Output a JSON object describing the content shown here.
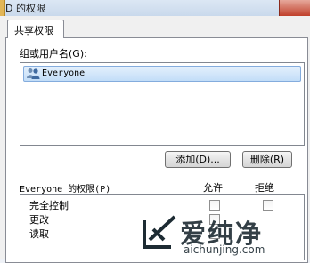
{
  "window": {
    "title": "D 的权限"
  },
  "tabs": [
    {
      "label": "共享权限",
      "active": true
    }
  ],
  "groups": {
    "label": "组或用户名(G):",
    "items": [
      {
        "name": "Everyone",
        "icon": "user-group-icon",
        "selected": true
      }
    ]
  },
  "buttons": {
    "add": "添加(D)...",
    "remove": "删除(R)"
  },
  "permissions": {
    "header": "Everyone 的权限(P)",
    "allow_label": "允许",
    "deny_label": "拒绝",
    "rows": [
      {
        "name": "完全控制",
        "allow": false,
        "deny": false
      },
      {
        "name": "更改",
        "allow": false,
        "deny": false
      },
      {
        "name": "读取",
        "allow": false,
        "deny": false
      }
    ]
  },
  "watermark": {
    "text": "爱纯净",
    "url": "aichunjing.com"
  }
}
